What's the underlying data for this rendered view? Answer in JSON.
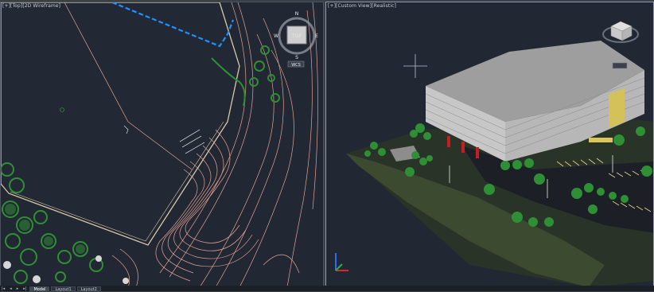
{
  "viewports": {
    "left": {
      "label": "[+][Top][2D Wireframe]"
    },
    "right": {
      "label": "[+][Custom View][Realistic]"
    }
  },
  "viewcube": {
    "compass": {
      "north": "N",
      "south": "S",
      "east": "E",
      "west": "W"
    },
    "face": "TOP",
    "wcs": "WCS"
  },
  "layout_tabs": {
    "nav_prev_first": "|◂",
    "nav_prev": "◂",
    "nav_next": "▸",
    "nav_next_last": "▸|",
    "items": [
      {
        "label": "Model",
        "active": true
      },
      {
        "label": "Layout1",
        "active": false
      },
      {
        "label": "Layout2",
        "active": false
      }
    ]
  },
  "colors": {
    "viewport_bg": "#212733",
    "site_lines": "#e3a394",
    "plants": "#2f8f34",
    "selection": "#1e90ff",
    "building_roof": "#9e9e9e"
  }
}
